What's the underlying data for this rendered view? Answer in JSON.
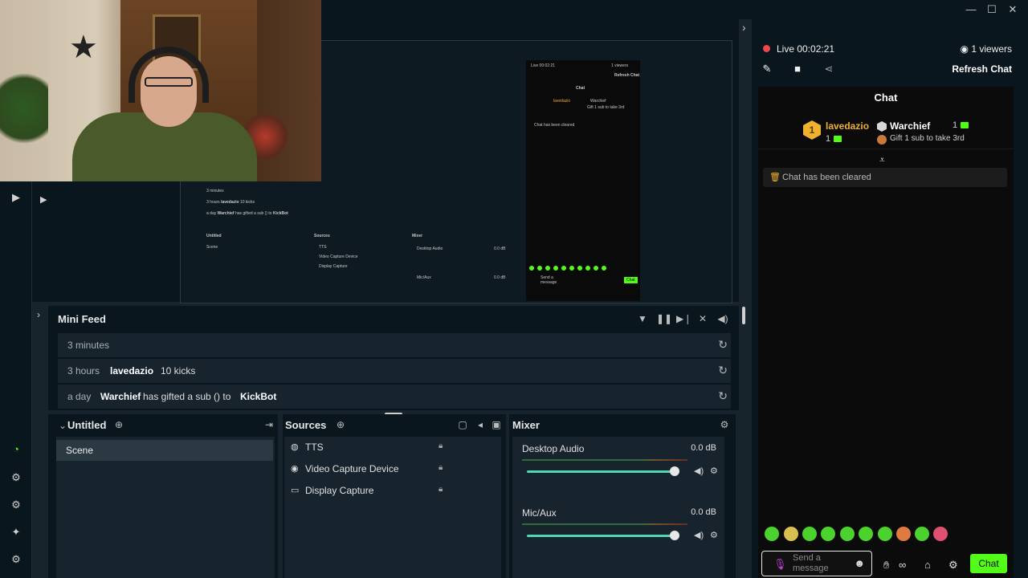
{
  "window": {
    "minimize": "—",
    "maximize": "☐",
    "close": "✕"
  },
  "preview": {
    "nested": {
      "mf_rows": [
        {
          "time": "3 minutes"
        },
        {
          "time": "3 hours",
          "name": "lavedazio",
          "text": "10 kicks"
        },
        {
          "time": "a day",
          "name": "Warchief",
          "text": "has gifted a sub () to",
          "target": "KickBot"
        }
      ],
      "scene_title": "Untitled",
      "scene": "Scene",
      "sources_title": "Sources",
      "sources": [
        "TTS",
        "Video Capture Device",
        "Display Capture"
      ],
      "mixer_title": "Mixer",
      "desktop": "Desktop Audio",
      "mic": "Mic/Aux",
      "db": "0.0 dB",
      "live": "Live 00:02:21",
      "viewers": "1 viewers",
      "refresh": "Refresh Chat",
      "chat": "Chat",
      "lname1": "lavedazio",
      "lname2": "Warchief",
      "gift": "Gift 1 sub to take 3rd",
      "cleared": "Chat has been cleared",
      "send": "Send a message",
      "chat_btn": "Chat"
    }
  },
  "minifeed": {
    "title": "Mini Feed",
    "rows": [
      {
        "time": "3 minutes"
      },
      {
        "time": "3 hours",
        "name": "lavedazio",
        "text": "10 kicks"
      },
      {
        "time": "a day",
        "name": "Warchief",
        "text": "has gifted a sub () to",
        "target": "KickBot"
      }
    ]
  },
  "scenes": {
    "title": "Untitled",
    "items": [
      "Scene"
    ]
  },
  "sources": {
    "title": "Sources",
    "items": [
      "TTS",
      "Video Capture Device",
      "Display Capture"
    ]
  },
  "mixer": {
    "title": "Mixer",
    "channels": [
      {
        "name": "Desktop Audio",
        "db": "0.0 dB",
        "level": 1.0
      },
      {
        "name": "Mic/Aux",
        "db": "0.0 dB",
        "level": 1.0
      }
    ]
  },
  "stream": {
    "live_label": "Live",
    "time": "00:02:21",
    "viewers": "1 viewers",
    "refresh": "Refresh Chat"
  },
  "chat": {
    "title": "Chat",
    "leaderboard": {
      "first": {
        "rank": "1",
        "name": "lavedazio",
        "count": "1"
      },
      "second": {
        "name": "Warchief",
        "count": "1"
      },
      "gift_rank": "3",
      "gift_text": "Gift 1 sub to take 3rd"
    },
    "cleared": "Chat has been cleared",
    "placeholder": "Send a message",
    "send_button": "Chat"
  },
  "colors": {
    "accent": "#53fc18",
    "live": "#f04848",
    "gold": "#f0b030",
    "panel": "#09161d",
    "row": "#17242d"
  }
}
